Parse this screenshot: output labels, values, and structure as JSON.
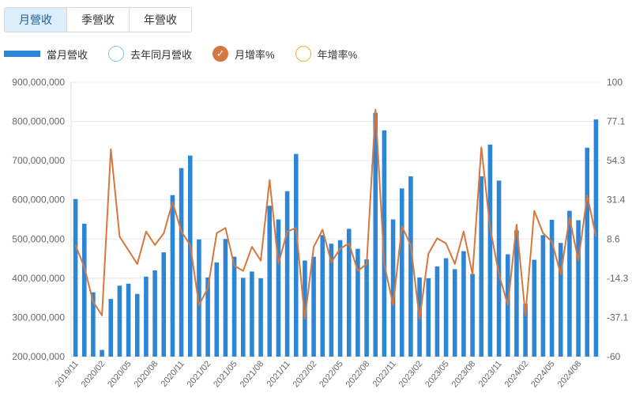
{
  "tabs": [
    {
      "label": "月營收",
      "active": true
    },
    {
      "label": "季營收",
      "active": false
    },
    {
      "label": "年營收",
      "active": false
    }
  ],
  "legend": [
    {
      "label": "當月營收",
      "kind": "bar",
      "color": "#2d85d6"
    },
    {
      "label": "去年同月營收",
      "kind": "circle",
      "color": "#87c4ea"
    },
    {
      "label": "月增率%",
      "kind": "check",
      "color": "#d6773f"
    },
    {
      "label": "年增率%",
      "kind": "circle",
      "color": "#e3b33a"
    }
  ],
  "chart_data": {
    "type": "bar",
    "x": [
      "2019/11",
      "2019/12",
      "2020/01",
      "2020/02",
      "2020/03",
      "2020/04",
      "2020/05",
      "2020/06",
      "2020/07",
      "2020/08",
      "2020/09",
      "2020/10",
      "2020/11",
      "2020/12",
      "2021/01",
      "2021/02",
      "2021/03",
      "2021/04",
      "2021/05",
      "2021/06",
      "2021/07",
      "2021/08",
      "2021/09",
      "2021/10",
      "2021/11",
      "2021/12",
      "2022/01",
      "2022/02",
      "2022/03",
      "2022/04",
      "2022/05",
      "2022/06",
      "2022/07",
      "2022/08",
      "2022/09",
      "2022/10",
      "2022/11",
      "2022/12",
      "2023/01",
      "2023/02",
      "2023/03",
      "2023/04",
      "2023/05",
      "2023/06",
      "2023/07",
      "2023/08",
      "2023/09",
      "2023/10",
      "2023/11",
      "2023/12",
      "2024/01",
      "2024/02",
      "2024/03",
      "2024/04",
      "2024/05",
      "2024/06",
      "2024/07",
      "2024/08",
      "2024/09",
      "2024/10"
    ],
    "x_tick_labels": [
      "2019/11",
      "2020/02",
      "2020/05",
      "2020/08",
      "2020/11",
      "2021/02",
      "2021/05",
      "2021/08",
      "2021/11",
      "2022/02",
      "2022/05",
      "2022/08",
      "2022/11",
      "2023/02",
      "2023/05",
      "2023/08",
      "2023/11",
      "2024/02",
      "2024/05",
      "2024/08"
    ],
    "series": [
      {
        "name": "當月營收",
        "axis": "left",
        "kind": "bar",
        "color": "#2d85d6",
        "values": [
          602000000,
          539000000,
          364000000,
          217000000,
          347000000,
          381000000,
          386000000,
          360000000,
          404000000,
          420000000,
          466000000,
          612000000,
          681000000,
          713000000,
          499000000,
          402000000,
          440000000,
          500000000,
          455000000,
          401000000,
          417000000,
          400000000,
          585000000,
          550000000,
          622000000,
          717000000,
          445000000,
          455000000,
          510000000,
          488000000,
          497000000,
          526000000,
          475000000,
          448000000,
          822000000,
          777000000,
          550000000,
          629000000,
          660000000,
          402000000,
          400000000,
          430000000,
          451000000,
          423000000,
          469000000,
          411000000,
          660000000,
          741000000,
          649000000,
          461000000,
          522000000,
          335000000,
          447000000,
          510000000,
          549000000,
          490000000,
          572000000,
          548000000,
          733000000,
          805000000
        ]
      },
      {
        "name": "月增率%",
        "axis": "right",
        "kind": "line",
        "color": "#d6773f",
        "values": [
          5,
          -8,
          -28,
          -36,
          61,
          10,
          2,
          -6,
          13,
          5,
          12,
          30,
          13,
          5,
          -30,
          -20,
          12,
          15,
          -7,
          -10,
          4,
          -4,
          43,
          -6,
          13,
          15,
          -38,
          4,
          14,
          -5,
          3,
          6,
          -10,
          -6,
          84,
          -6,
          -30,
          16,
          5,
          -38,
          0,
          9,
          6,
          -6,
          13,
          -12,
          62,
          15,
          -12,
          -30,
          17,
          -36,
          25,
          12,
          7,
          -12,
          21,
          -4,
          34,
          10
        ]
      }
    ],
    "left_axis": {
      "min": 200000000,
      "max": 900000000,
      "ticks": [
        "900,000,000",
        "800,000,000",
        "700,000,000",
        "600,000,000",
        "500,000,000",
        "400,000,000",
        "300,000,000",
        "200,000,000"
      ]
    },
    "right_axis": {
      "min": -60,
      "max": 100,
      "ticks": [
        "100",
        "77.1",
        "54.3",
        "31.4",
        "8.6",
        "-14.3",
        "-37.1",
        "-60"
      ]
    },
    "grid": true
  }
}
